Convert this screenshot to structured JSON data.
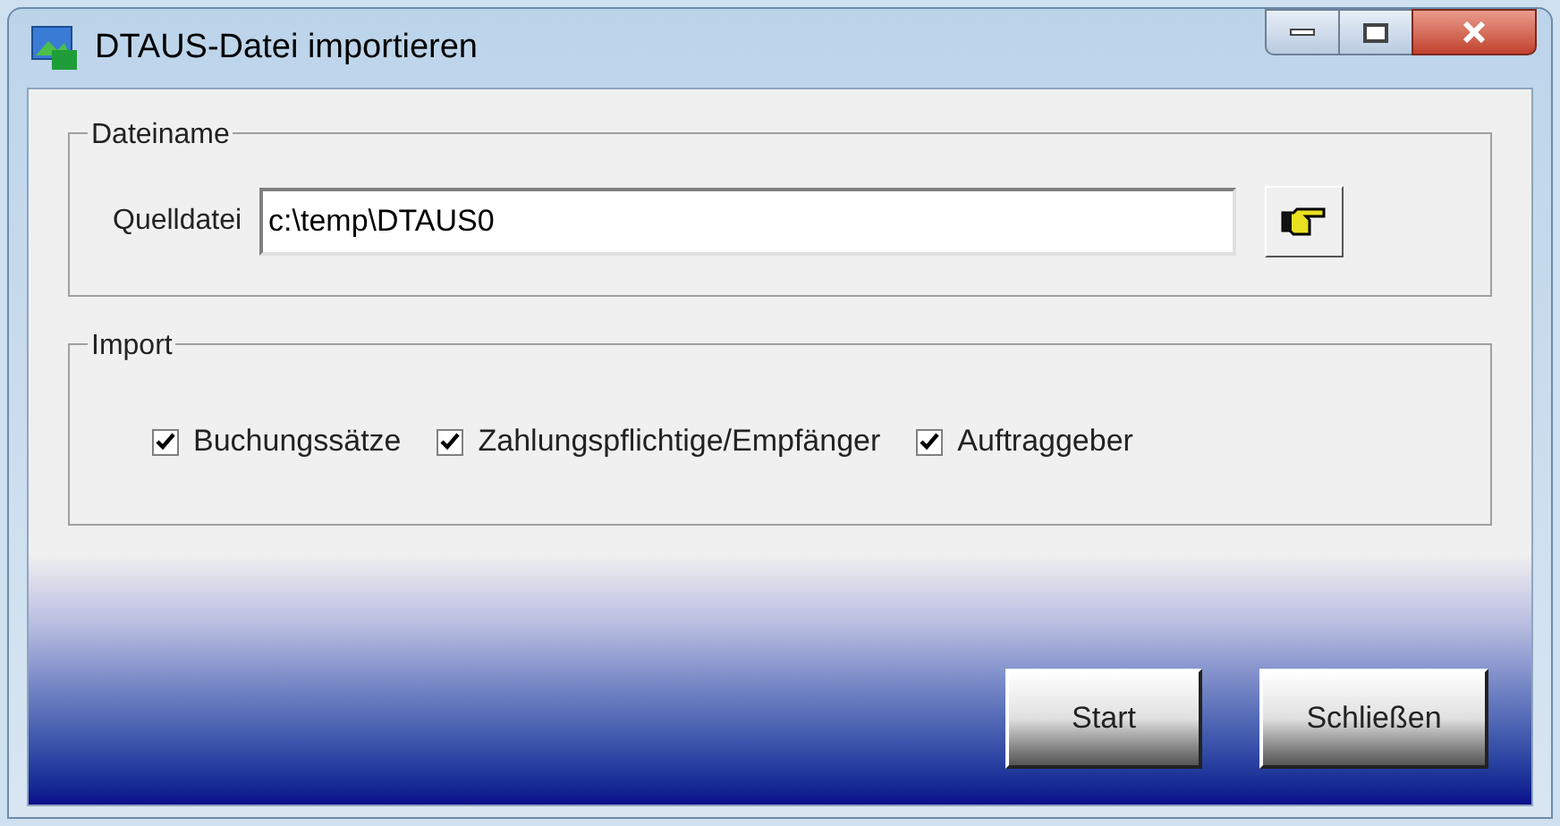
{
  "window": {
    "title": "DTAUS-Datei importieren"
  },
  "file_group": {
    "legend": "Dateiname",
    "label": "Quelldatei",
    "value": "c:\\temp\\DTAUS0"
  },
  "import_group": {
    "legend": "Import",
    "options": [
      {
        "label": "Buchungssätze",
        "checked": true
      },
      {
        "label": "Zahlungspflichtige/Empfänger",
        "checked": true
      },
      {
        "label": "Auftraggeber",
        "checked": true
      }
    ]
  },
  "buttons": [
    "Start",
    "Schließen"
  ]
}
